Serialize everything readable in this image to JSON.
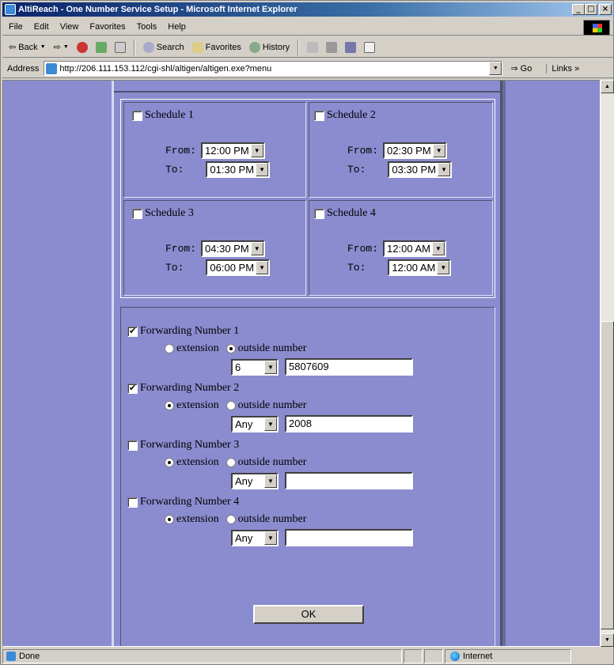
{
  "window": {
    "title": "AltiReach - One Number Service Setup - Microsoft Internet Explorer"
  },
  "menu": [
    "File",
    "Edit",
    "View",
    "Favorites",
    "Tools",
    "Help"
  ],
  "toolbar": {
    "back": "Back",
    "search": "Search",
    "favorites": "Favorites",
    "history": "History"
  },
  "address": {
    "label": "Address",
    "url": "http://206.111.153.112/cgi-shl/altigen/altigen.exe?menu",
    "go": "Go",
    "links": "Links"
  },
  "schedules": [
    {
      "label": "Schedule 1",
      "checked": false,
      "from": "12:00 PM",
      "to": "01:30 PM"
    },
    {
      "label": "Schedule 2",
      "checked": false,
      "from": "02:30 PM",
      "to": "03:30 PM"
    },
    {
      "label": "Schedule 3",
      "checked": false,
      "from": "04:30 PM",
      "to": "06:00 PM"
    },
    {
      "label": "Schedule 4",
      "checked": false,
      "from": "12:00 AM",
      "to": "12:00 AM"
    }
  ],
  "labels": {
    "from": "From:",
    "to": "To:",
    "extension": "extension",
    "outside": "outside number"
  },
  "forwarding": [
    {
      "label": "Forwarding Number 1",
      "checked": true,
      "type": "outside",
      "prefix": "6",
      "number": "5807609"
    },
    {
      "label": "Forwarding Number 2",
      "checked": true,
      "type": "extension",
      "prefix": "Any",
      "number": "2008"
    },
    {
      "label": "Forwarding Number 3",
      "checked": false,
      "type": "extension",
      "prefix": "Any",
      "number": ""
    },
    {
      "label": "Forwarding Number 4",
      "checked": false,
      "type": "extension",
      "prefix": "Any",
      "number": ""
    }
  ],
  "ok_label": "OK",
  "status": {
    "text": "Done",
    "zone": "Internet"
  }
}
